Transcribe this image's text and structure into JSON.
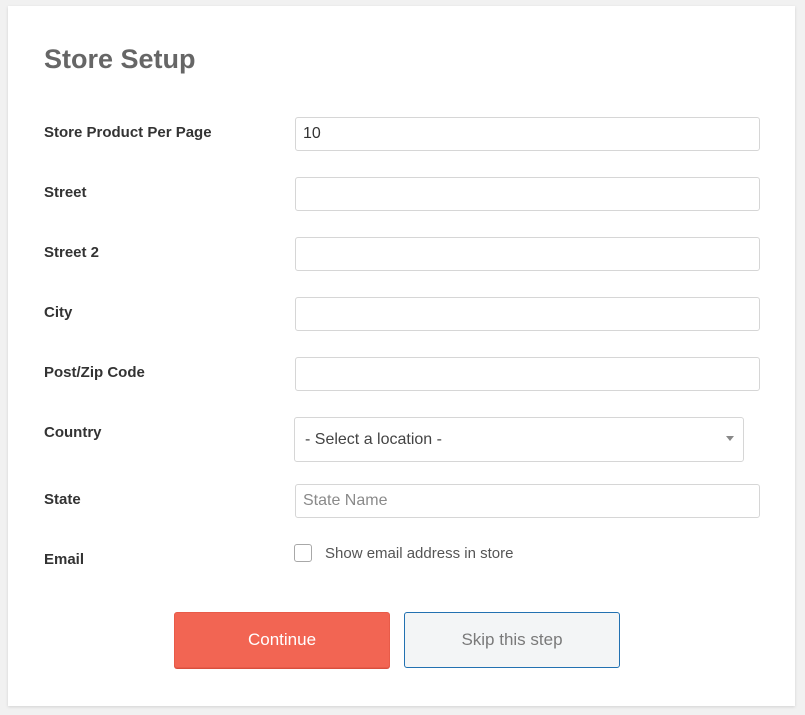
{
  "page": {
    "title": "Store Setup"
  },
  "fields": {
    "per_page": {
      "label": "Store Product Per Page",
      "value": "10"
    },
    "street": {
      "label": "Street",
      "value": ""
    },
    "street2": {
      "label": "Street 2",
      "value": ""
    },
    "city": {
      "label": "City",
      "value": ""
    },
    "zip": {
      "label": "Post/Zip Code",
      "value": ""
    },
    "country": {
      "label": "Country",
      "selected": "- Select a location -"
    },
    "state": {
      "label": "State",
      "value": "",
      "placeholder": "State Name"
    },
    "email": {
      "label": "Email",
      "checkbox_label": "Show email address in store",
      "checked": false
    }
  },
  "buttons": {
    "continue_label": "Continue",
    "skip_label": "Skip this step"
  },
  "colors": {
    "continue_bg": "#f26553",
    "skip_border": "#2271b1",
    "title": "#666666"
  },
  "icons": {
    "select_arrow": "caret-down-icon"
  }
}
